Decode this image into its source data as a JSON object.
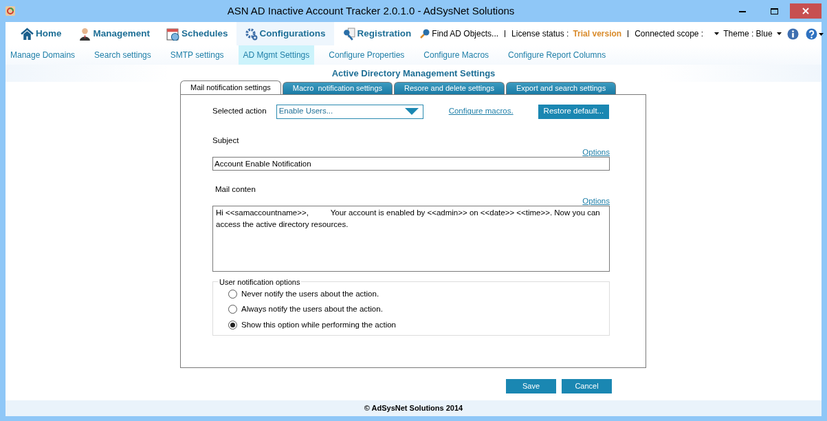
{
  "window": {
    "title": "ASN AD Inactive Account Tracker 2.0.1.0 - AdSysNet Solutions"
  },
  "main_menu": [
    {
      "label": "Home",
      "selected": false
    },
    {
      "label": "Management",
      "selected": false
    },
    {
      "label": "Schedules",
      "selected": false
    },
    {
      "label": "Configurations",
      "selected": true
    },
    {
      "label": "Registration",
      "selected": false
    }
  ],
  "toolbar": {
    "find": "Find AD Objects...",
    "license_label": "License status :",
    "license_value": "Trial version",
    "scope_label": "Connected scope :",
    "theme": "Theme : Blue"
  },
  "sub_menu": [
    {
      "label": "Manage Domains",
      "selected": false
    },
    {
      "label": "Search settings",
      "selected": false
    },
    {
      "label": "SMTP settings",
      "selected": false
    },
    {
      "label": "AD Mgmt Settings",
      "selected": true
    },
    {
      "label": "Configure Properties",
      "selected": false
    },
    {
      "label": "Configure Macros",
      "selected": false
    },
    {
      "label": "Configure Report Columns",
      "selected": false
    }
  ],
  "page_title": "Active Directory Management Settings",
  "tabs": [
    {
      "label": "Mail notification settings",
      "selected": true
    },
    {
      "label": "Macro  notification settings",
      "selected": false
    },
    {
      "label": "Resore and delete settings",
      "selected": false
    },
    {
      "label": "Export and search settings",
      "selected": false
    }
  ],
  "form": {
    "action_label": "Selected action",
    "action_value": "Enable Users...",
    "configure_link": "Configure macros.",
    "restore_button": "Restore default...",
    "subject_label": "Subject",
    "subject_options": "Options",
    "subject_value": "Account Enable Notification",
    "content_label": "Mail conten",
    "content_options": "Options",
    "content_value": "Hi <<samaccountname>>,          Your account is enabled by <<admin>> on <<date>> <<time>>. Now you can access the active directory resources.",
    "notify_group": "User notification options",
    "notify_options": [
      {
        "label": "Never notify the users about the action.",
        "selected": false
      },
      {
        "label": "Always notify the users about the action.",
        "selected": false
      },
      {
        "label": "Show this option while performing the action",
        "selected": true
      }
    ]
  },
  "buttons": [
    "Save",
    "Cancel"
  ],
  "footer": "© AdSysNet Solutions 2014"
}
